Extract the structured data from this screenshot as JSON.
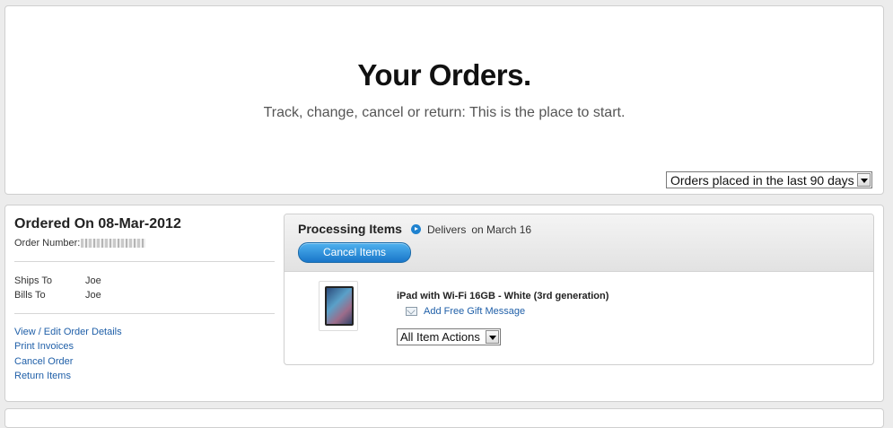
{
  "header": {
    "title": "Your Orders.",
    "subtitle": "Track, change, cancel or return: This is the place to start.",
    "filter": {
      "selected": "Orders placed in the last 90 days"
    }
  },
  "order": {
    "ordered_on": "Ordered On 08-Mar-2012",
    "order_number_label": "Order Number:",
    "ships_to_label": "Ships To",
    "ships_to_value": "Joe",
    "bills_to_label": "Bills To",
    "bills_to_value": "Joe",
    "links": {
      "view_edit": "View / Edit Order Details",
      "print_invoices": "Print Invoices",
      "cancel_order": "Cancel Order",
      "return_items": "Return Items"
    },
    "items": {
      "status": "Processing Items",
      "delivers_label": "Delivers",
      "delivers_date": "on March 16",
      "cancel_button": "Cancel Items",
      "product_name": "iPad with Wi-Fi 16GB - White (3rd generation)",
      "gift_link": "Add Free Gift Message",
      "actions_selected": "All Item Actions"
    }
  },
  "colors": {
    "link": "#1f5fa8",
    "button_blue": "#1976c9",
    "status_icon": "#1f82cf"
  }
}
